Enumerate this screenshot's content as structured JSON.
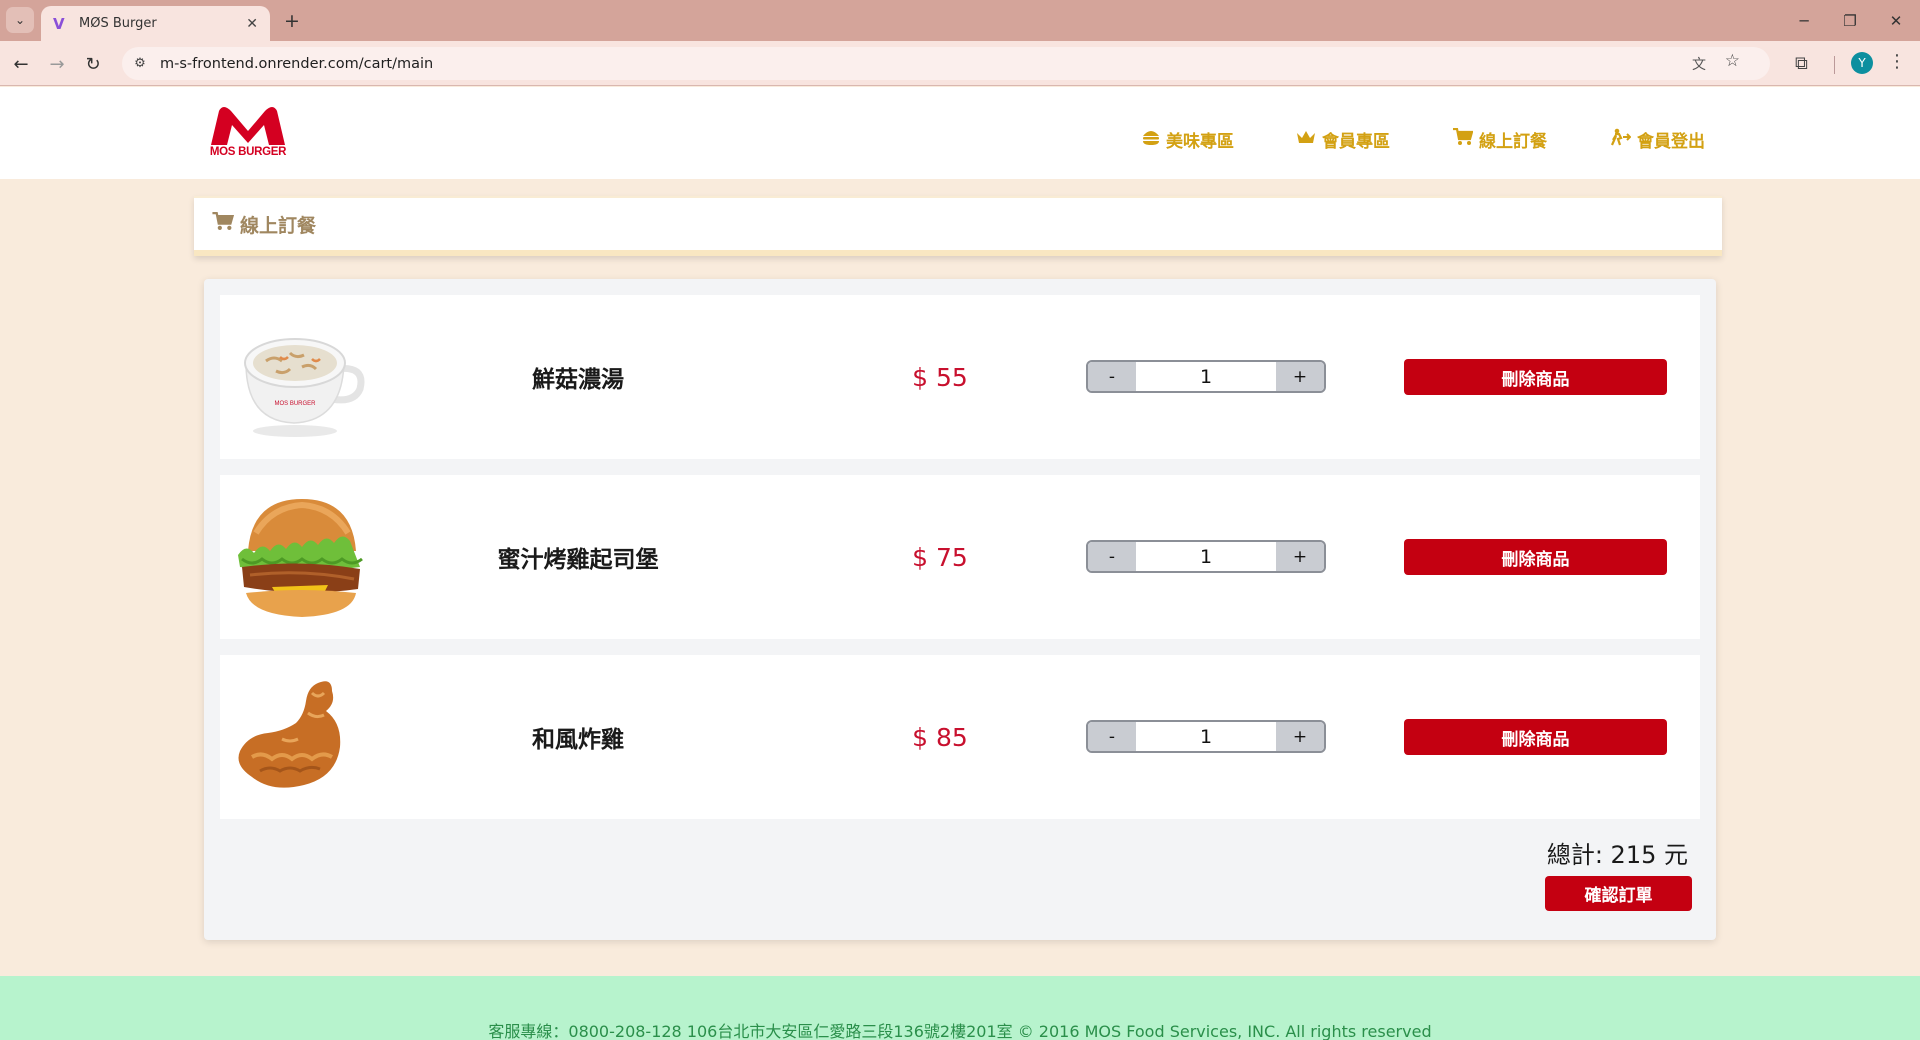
{
  "browser": {
    "tab_title": "MØS Burger",
    "tab_favicon": "V",
    "url": "m-s-frontend.onrender.com/cart/main",
    "profile_initial": "Y"
  },
  "header": {
    "logo_text": "MOS BURGER",
    "menu": [
      {
        "label": "美味專區",
        "icon": "burger-icon"
      },
      {
        "label": "會員專區",
        "icon": "crown-icon"
      },
      {
        "label": "線上訂餐",
        "icon": "cart-icon"
      },
      {
        "label": "會員登出",
        "icon": "logout-icon"
      }
    ]
  },
  "section": {
    "title": "線上訂餐"
  },
  "cart": {
    "items": [
      {
        "name": "鮮菇濃湯",
        "price": "$ 55",
        "qty": "1",
        "minus": "-",
        "plus": "+",
        "delete_label": "刪除商品",
        "image": "mushroom-soup"
      },
      {
        "name": "蜜汁烤雞起司堡",
        "price": "$ 75",
        "qty": "1",
        "minus": "-",
        "plus": "+",
        "delete_label": "刪除商品",
        "image": "chicken-cheese-burger"
      },
      {
        "name": "和風炸雞",
        "price": "$ 85",
        "qty": "1",
        "minus": "-",
        "plus": "+",
        "delete_label": "刪除商品",
        "image": "fried-chicken"
      }
    ],
    "total": "總計: 215 元",
    "confirm_label": "確認訂單"
  },
  "footer": {
    "text": "客服專線：0800-208-128 106台北市大安區仁愛路三段136號2樓201室 © 2016 MOS Food Services, INC. All rights reserved"
  },
  "colors": {
    "brand_red": "#c40011",
    "menu_gold": "#d3a113",
    "footer_green": "#b7f3cd"
  }
}
